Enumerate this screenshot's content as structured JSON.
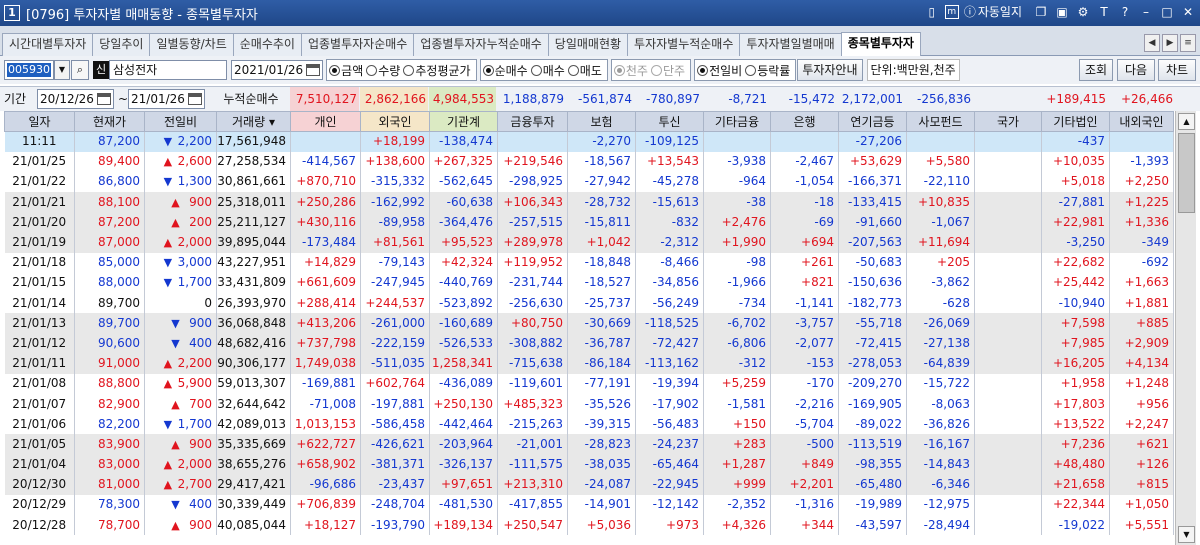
{
  "window": {
    "num": "1",
    "title": "[0796] 투자자별 매매동향 - 종목별투자자",
    "autolog": "자동일지"
  },
  "tabs": [
    "시간대별투자자",
    "당일추이",
    "일별동향/차트",
    "순매수추이",
    "업종별투자자순매수",
    "업종별투자자누적순매수",
    "당일매매현황",
    "투자자별누적순매수",
    "투자자별일별매매",
    "종목별투자자"
  ],
  "controls": {
    "code": "005930",
    "sin": "신",
    "name": "삼성전자",
    "date": "2021/01/26",
    "g1": [
      "금액",
      "수량",
      "추정평균가"
    ],
    "g2": [
      "순매수",
      "매수",
      "매도"
    ],
    "g3": [
      "천주",
      "단주"
    ],
    "g4": [
      "전일비",
      "등락률"
    ],
    "info_btn": "투자자안내",
    "unit": "단위:백만원,천주",
    "search_btn": "조회",
    "next_btn": "다음",
    "chart_btn": "차트"
  },
  "summary": {
    "period_label": "기간",
    "from": "20/12/26",
    "to": "21/01/26",
    "cum_label": "누적순매수",
    "values": [
      "7,510,127",
      "2,862,166",
      "4,984,553",
      "1,188,879",
      "-561,874",
      "-780,897",
      "-8,721",
      "-15,472",
      "2,172,001",
      "-256,836",
      "",
      "+189,415",
      "+26,466"
    ]
  },
  "columns": [
    "일자",
    "현재가",
    "전일비",
    "거래량",
    "개인",
    "외국인",
    "기관계",
    "금융투자",
    "보험",
    "투신",
    "기타금융",
    "은행",
    "연기금등",
    "사모펀드",
    "국가",
    "기타법인",
    "내외국인"
  ],
  "rows": [
    [
      "11:11",
      "87,200",
      "▼",
      "2,200",
      "17,561,948",
      "",
      "+18,199",
      "-138,474",
      "",
      "-2,270",
      "-109,125",
      "",
      "",
      "-27,206",
      "",
      "",
      "-437",
      ""
    ],
    [
      "21/01/25",
      "89,400",
      "▲",
      "2,600",
      "27,258,534",
      "-414,567",
      "+138,600",
      "+267,325",
      "+219,546",
      "-18,567",
      "+13,543",
      "-3,938",
      "-2,467",
      "+53,629",
      "+5,580",
      "",
      "+10,035",
      "-1,393"
    ],
    [
      "21/01/22",
      "86,800",
      "▼",
      "1,300",
      "30,861,661",
      "+870,710",
      "-315,332",
      "-562,645",
      "-298,925",
      "-27,942",
      "-45,278",
      "-964",
      "-1,054",
      "-166,371",
      "-22,110",
      "",
      "+5,018",
      "+2,250"
    ],
    [
      "21/01/21",
      "88,100",
      "▲",
      "900",
      "25,318,011",
      "+250,286",
      "-162,992",
      "-60,638",
      "+106,343",
      "-28,732",
      "-15,613",
      "-38",
      "-18",
      "-133,415",
      "+10,835",
      "",
      "-27,881",
      "+1,225"
    ],
    [
      "21/01/20",
      "87,200",
      "▲",
      "200",
      "25,211,127",
      "+430,116",
      "-89,958",
      "-364,476",
      "-257,515",
      "-15,811",
      "-832",
      "+2,476",
      "-69",
      "-91,660",
      "-1,067",
      "",
      "+22,981",
      "+1,336"
    ],
    [
      "21/01/19",
      "87,000",
      "▲",
      "2,000",
      "39,895,044",
      "-173,484",
      "+81,561",
      "+95,523",
      "+289,978",
      "+1,042",
      "-2,312",
      "+1,990",
      "+694",
      "-207,563",
      "+11,694",
      "",
      "-3,250",
      "-349"
    ],
    [
      "21/01/18",
      "85,000",
      "▼",
      "3,000",
      "43,227,951",
      "+14,829",
      "-79,143",
      "+42,324",
      "+119,952",
      "-18,848",
      "-8,466",
      "-98",
      "+261",
      "-50,683",
      "+205",
      "",
      "+22,682",
      "-692"
    ],
    [
      "21/01/15",
      "88,000",
      "▼",
      "1,700",
      "33,431,809",
      "+661,609",
      "-247,945",
      "-440,769",
      "-231,744",
      "-18,527",
      "-34,856",
      "-1,966",
      "+821",
      "-150,636",
      "-3,862",
      "",
      "+25,442",
      "+1,663"
    ],
    [
      "21/01/14",
      "89,700",
      "",
      "0",
      "26,393,970",
      "+288,414",
      "+244,537",
      "-523,892",
      "-256,630",
      "-25,737",
      "-56,249",
      "-734",
      "-1,141",
      "-182,773",
      "-628",
      "",
      "-10,940",
      "+1,881"
    ],
    [
      "21/01/13",
      "89,700",
      "▼",
      "900",
      "36,068,848",
      "+413,206",
      "-261,000",
      "-160,689",
      "+80,750",
      "-30,669",
      "-118,525",
      "-6,702",
      "-3,757",
      "-55,718",
      "-26,069",
      "",
      "+7,598",
      "+885"
    ],
    [
      "21/01/12",
      "90,600",
      "▼",
      "400",
      "48,682,416",
      "+737,798",
      "-222,159",
      "-526,533",
      "-308,882",
      "-36,787",
      "-72,427",
      "-6,806",
      "-2,077",
      "-72,415",
      "-27,138",
      "",
      "+7,985",
      "+2,909"
    ],
    [
      "21/01/11",
      "91,000",
      "▲",
      "2,200",
      "90,306,177",
      "1,749,038",
      "-511,035",
      "1,258,341",
      "-715,638",
      "-86,184",
      "-113,162",
      "-312",
      "-153",
      "-278,053",
      "-64,839",
      "",
      "+16,205",
      "+4,134"
    ],
    [
      "21/01/08",
      "88,800",
      "▲",
      "5,900",
      "59,013,307",
      "-169,881",
      "+602,764",
      "-436,089",
      "-119,601",
      "-77,191",
      "-19,394",
      "+5,259",
      "-170",
      "-209,270",
      "-15,722",
      "",
      "+1,958",
      "+1,248"
    ],
    [
      "21/01/07",
      "82,900",
      "▲",
      "700",
      "32,644,642",
      "-71,008",
      "-197,881",
      "+250,130",
      "+485,323",
      "-35,526",
      "-17,902",
      "-1,581",
      "-2,216",
      "-169,905",
      "-8,063",
      "",
      "+17,803",
      "+956"
    ],
    [
      "21/01/06",
      "82,200",
      "▼",
      "1,700",
      "42,089,013",
      "1,013,153",
      "-586,458",
      "-442,464",
      "-215,263",
      "-39,315",
      "-56,483",
      "+150",
      "-5,704",
      "-89,022",
      "-36,826",
      "",
      "+13,522",
      "+2,247"
    ],
    [
      "21/01/05",
      "83,900",
      "▲",
      "900",
      "35,335,669",
      "+622,727",
      "-426,621",
      "-203,964",
      "-21,001",
      "-28,823",
      "-24,237",
      "+283",
      "-500",
      "-113,519",
      "-16,167",
      "",
      "+7,236",
      "+621"
    ],
    [
      "21/01/04",
      "83,000",
      "▲",
      "2,000",
      "38,655,276",
      "+658,902",
      "-381,371",
      "-326,137",
      "-111,575",
      "-38,035",
      "-65,464",
      "+1,287",
      "+849",
      "-98,355",
      "-14,843",
      "",
      "+48,480",
      "+126"
    ],
    [
      "20/12/30",
      "81,000",
      "▲",
      "2,700",
      "29,417,421",
      "-96,686",
      "-23,437",
      "+97,651",
      "+213,310",
      "-24,087",
      "-22,945",
      "+999",
      "+2,201",
      "-65,480",
      "-6,346",
      "",
      "+21,658",
      "+815"
    ],
    [
      "20/12/29",
      "78,300",
      "▼",
      "400",
      "30,339,449",
      "+706,839",
      "-248,704",
      "-481,530",
      "-417,855",
      "-14,901",
      "-12,142",
      "-2,352",
      "-1,316",
      "-19,989",
      "-12,975",
      "",
      "+22,344",
      "+1,050"
    ],
    [
      "20/12/28",
      "78,700",
      "▲",
      "900",
      "40,085,044",
      "+18,127",
      "-193,790",
      "+189,134",
      "+250,547",
      "+5,036",
      "+973",
      "+4,326",
      "+344",
      "-43,597",
      "-28,494",
      "",
      "-19,022",
      "+5,551"
    ]
  ]
}
